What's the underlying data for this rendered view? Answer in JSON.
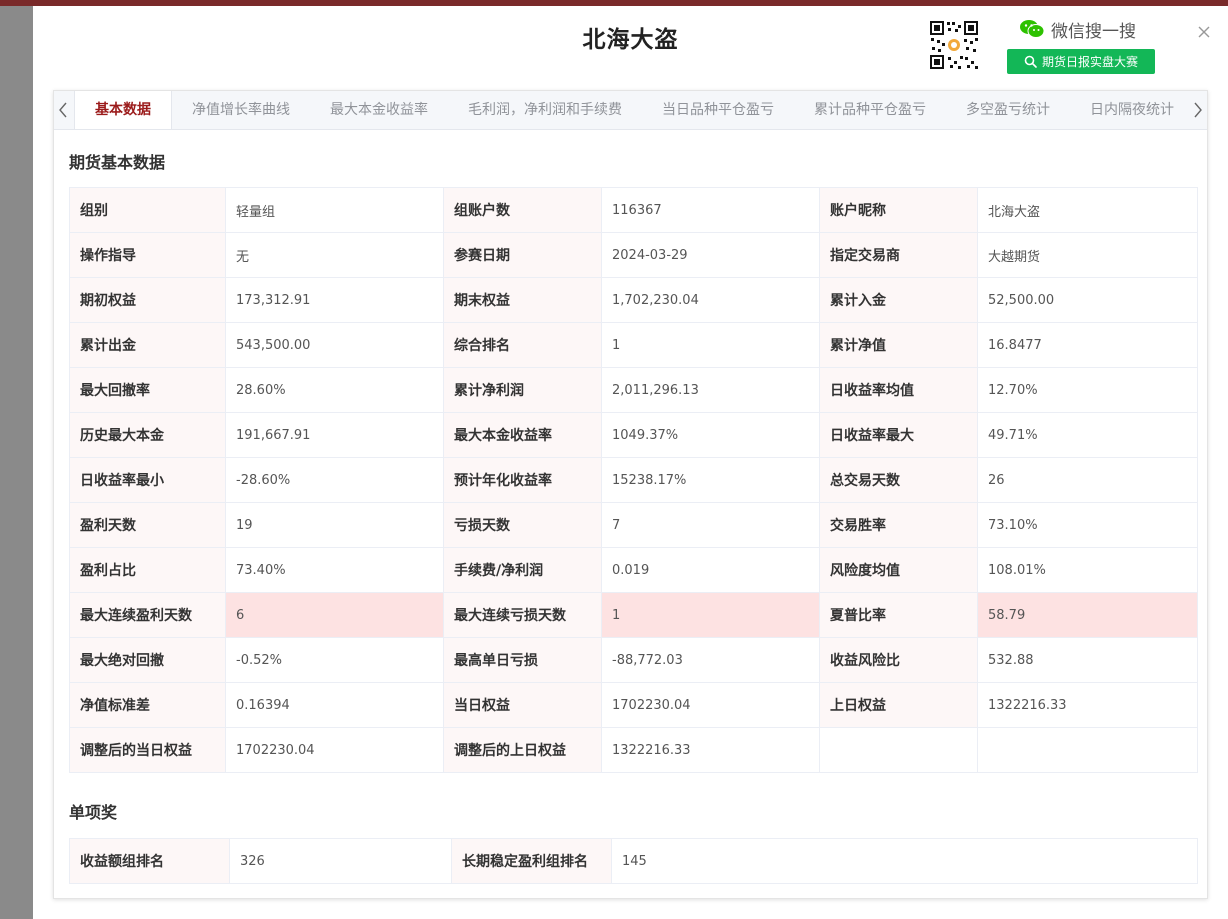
{
  "modal": {
    "title": "北海大盗",
    "wechat_text": "微信搜一搜",
    "wechat_search_label": "期货日报实盘大赛"
  },
  "tabs": [
    {
      "label": "基本数据",
      "active": true
    },
    {
      "label": "净值增长率曲线",
      "active": false
    },
    {
      "label": "最大本金收益率",
      "active": false
    },
    {
      "label": "毛利润，净利润和手续费",
      "active": false
    },
    {
      "label": "当日品种平仓盈亏",
      "active": false
    },
    {
      "label": "累计品种平仓盈亏",
      "active": false
    },
    {
      "label": "多空盈亏统计",
      "active": false
    },
    {
      "label": "日内隔夜统计",
      "active": false
    }
  ],
  "basic": {
    "section_title": "期货基本数据",
    "rows": [
      [
        [
          "组别",
          "轻量组"
        ],
        [
          "组账户数",
          "116367"
        ],
        [
          "账户昵称",
          "北海大盗"
        ]
      ],
      [
        [
          "操作指导",
          "无"
        ],
        [
          "参赛日期",
          "2024-03-29"
        ],
        [
          "指定交易商",
          "大越期货"
        ]
      ],
      [
        [
          "期初权益",
          "173,312.91"
        ],
        [
          "期末权益",
          "1,702,230.04"
        ],
        [
          "累计入金",
          "52,500.00"
        ]
      ],
      [
        [
          "累计出金",
          "543,500.00"
        ],
        [
          "综合排名",
          "1"
        ],
        [
          "累计净值",
          "16.8477"
        ]
      ],
      [
        [
          "最大回撤率",
          "28.60%"
        ],
        [
          "累计净利润",
          "2,011,296.13"
        ],
        [
          "日收益率均值",
          "12.70%"
        ]
      ],
      [
        [
          "历史最大本金",
          "191,667.91"
        ],
        [
          "最大本金收益率",
          "1049.37%"
        ],
        [
          "日收益率最大",
          "49.71%"
        ]
      ],
      [
        [
          "日收益率最小",
          "-28.60%"
        ],
        [
          "预计年化收益率",
          "15238.17%"
        ],
        [
          "总交易天数",
          "26"
        ]
      ],
      [
        [
          "盈利天数",
          "19"
        ],
        [
          "亏损天数",
          "7"
        ],
        [
          "交易胜率",
          "73.10%"
        ]
      ],
      [
        [
          "盈利占比",
          "73.40%"
        ],
        [
          "手续费/净利润",
          "0.019"
        ],
        [
          "风险度均值",
          "108.01%"
        ]
      ],
      [
        [
          "最大连续盈利天数",
          "6"
        ],
        [
          "最大连续亏损天数",
          "1"
        ],
        [
          "夏普比率",
          "58.79"
        ]
      ],
      [
        [
          "最大绝对回撤",
          "-0.52%"
        ],
        [
          "最高单日亏损",
          "-88,772.03"
        ],
        [
          "收益风险比",
          "532.88"
        ]
      ],
      [
        [
          "净值标准差",
          "0.16394"
        ],
        [
          "当日权益",
          "1702230.04"
        ],
        [
          "上日权益",
          "1322216.33"
        ]
      ],
      [
        [
          "调整后的当日权益",
          "1702230.04"
        ],
        [
          "调整后的上日权益",
          "1322216.33"
        ],
        [
          "",
          ""
        ]
      ]
    ]
  },
  "awards": {
    "section_title": "单项奖",
    "rows": [
      [
        [
          "收益额组排名",
          "326"
        ],
        [
          "长期稳定盈利组排名",
          "145"
        ]
      ]
    ]
  },
  "colors": {
    "accent": "#9b1b1b",
    "wechat_green": "#13b757",
    "label_bg": "#fdf7f7",
    "highlight_bg": "#fde2e2"
  }
}
